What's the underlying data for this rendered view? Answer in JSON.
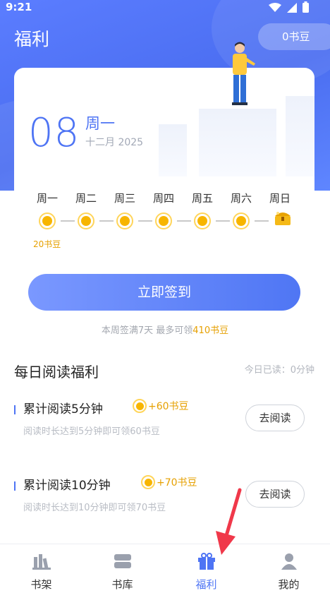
{
  "status_bar": {
    "time": "9:21"
  },
  "header": {
    "title": "福利",
    "beans_label": "0书豆"
  },
  "date_card": {
    "day": "08",
    "weekday": "周一",
    "month_year": "十二月 2025"
  },
  "week": {
    "days": [
      "周一",
      "周二",
      "周三",
      "周四",
      "周五",
      "周六",
      "周日"
    ],
    "first_reward": "20书豆"
  },
  "signin": {
    "button_label": "立即签到",
    "note_prefix": "本周签满7天 最多可领",
    "note_highlight": "410书豆"
  },
  "reading": {
    "section_title": "每日阅读福利",
    "today_read": "今日已读：0分钟",
    "tasks": [
      {
        "title": "累计阅读5分钟",
        "bonus": "+60书豆",
        "desc": "阅读时长达到5分钟即可领60书豆",
        "action": "去阅读"
      },
      {
        "title": "累计阅读10分钟",
        "bonus": "+70书豆",
        "desc": "阅读时长达到10分钟即可领70书豆",
        "action": "去阅读"
      }
    ]
  },
  "tabs": [
    {
      "label": "书架"
    },
    {
      "label": "书库"
    },
    {
      "label": "福利"
    },
    {
      "label": "我的"
    }
  ],
  "colors": {
    "accent": "#4e74f4",
    "gold": "#e6a000",
    "hero": "#5b7dff",
    "annotation": "#f0384a"
  },
  "icons": [
    "wifi-icon",
    "signal-icon",
    "battery-icon",
    "bean-coin-icon",
    "treasure-chest-icon",
    "bookshelf-icon",
    "library-icon",
    "gift-icon",
    "person-icon"
  ]
}
